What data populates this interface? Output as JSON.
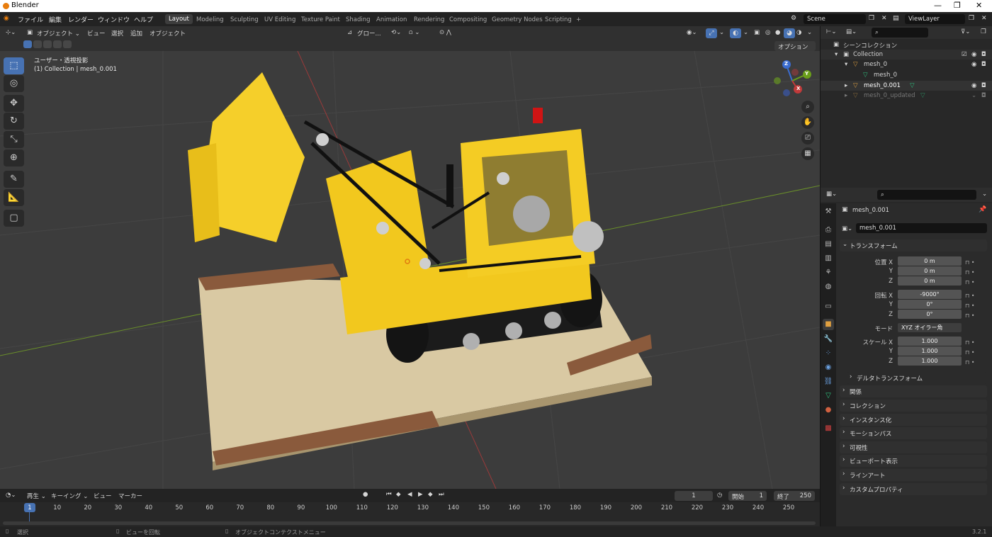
{
  "window": {
    "title": "Blender"
  },
  "menu": [
    "ファイル",
    "編集",
    "レンダー",
    "ウィンドウ",
    "ヘルプ"
  ],
  "workspaces": [
    "Layout",
    "Modeling",
    "Sculpting",
    "UV Editing",
    "Texture Paint",
    "Shading",
    "Animation",
    "Rendering",
    "Compositing",
    "Geometry Nodes",
    "Scripting"
  ],
  "workspace_add": "+",
  "scene": {
    "name": "Scene",
    "view_layer": "ViewLayer"
  },
  "viewport_header": {
    "mode": "オブジェクト ⌄",
    "view": "ビュー",
    "select": "選択",
    "add": "追加",
    "object": "オブジェクト",
    "transform_orientation": "グロー...",
    "options": "オプション ⌄"
  },
  "viewport": {
    "view_name": "ユーザー・透視投影",
    "collection_info": "(1) Collection | mesh_0.001",
    "gizmo": {
      "x": "X",
      "y": "Y",
      "z": "Z"
    }
  },
  "outliner": {
    "root": "シーンコレクション",
    "items": [
      {
        "label": "Collection",
        "indent": 1
      },
      {
        "label": "mesh_0",
        "indent": 2
      },
      {
        "label": "mesh_0",
        "indent": 3
      },
      {
        "label": "mesh_0.001",
        "indent": 2
      },
      {
        "label": "mesh_0_updated",
        "indent": 2
      }
    ]
  },
  "properties": {
    "object_name": "mesh_0.001",
    "datablock": "mesh_0.001",
    "transform_header": "トランスフォーム",
    "location_label": "位置 X",
    "rotation_label": "回転 X",
    "scale_label": "スケール X",
    "y": "Y",
    "z": "Z",
    "location": [
      "0 m",
      "0 m",
      "0 m"
    ],
    "rotation": [
      "-9000°",
      "0°",
      "0°"
    ],
    "mode_label": "モード",
    "mode_value": "XYZ オイラー角",
    "scale": [
      "1.000",
      "1.000",
      "1.000"
    ],
    "delta": "デルタトランスフォーム",
    "panels": [
      "関係",
      "コレクション",
      "インスタンス化",
      "モーションパス",
      "可視性",
      "ビューポート表示",
      "ラインアート",
      "カスタムプロパティ"
    ]
  },
  "timeline": {
    "playback": "再生 ⌄",
    "keying": "キーイング ⌄",
    "view": "ビュー",
    "marker": "マーカー",
    "current_frame": "1",
    "start_label": "開始",
    "start": "1",
    "end_label": "終了",
    "end": "250",
    "ticks": [
      "1",
      "10",
      "20",
      "30",
      "40",
      "50",
      "60",
      "70",
      "80",
      "90",
      "100",
      "110",
      "120",
      "130",
      "140",
      "150",
      "160",
      "170",
      "180",
      "190",
      "200",
      "210",
      "220",
      "230",
      "240",
      "250"
    ]
  },
  "status": {
    "select": "選択",
    "rotate": "ビューを回転",
    "context": "オブジェクトコンテクストメニュー",
    "version": "3.2.1"
  },
  "colors": {
    "accent": "#4772b3",
    "lego_yellow": "#f2c81e",
    "baseplate": "#e8dcc0",
    "brick": "#8a5a3c",
    "track": "#181818"
  }
}
